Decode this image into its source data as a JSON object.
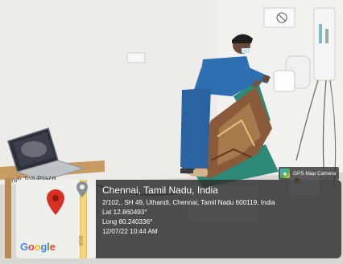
{
  "scene": {
    "wall_sign": "ndi Toll Plaza",
    "colors": {
      "wall": "#ecebe7",
      "floor": "#d8d6d1",
      "scrubs": "#2d6fb0",
      "chair": "#2e8a78",
      "saree": "#8a5a3a",
      "laptop_screen": "#2a2f38"
    }
  },
  "watermark": {
    "app_name": "GPS Map Camera",
    "icon": "gps-map-camera-logo-icon"
  },
  "map": {
    "brand": "Google",
    "road_label": "ECR",
    "pin_color": "#d93025",
    "icons": [
      "location-pin-icon",
      "gray-location-pin-icon"
    ]
  },
  "geotag": {
    "title": "Chennai, Tamil Nadu, India",
    "address": "2/102,, SH 49, Uthandi, Chennai, Tamil Nadu 600119, India",
    "latitude": "Lat 12.860493°",
    "longitude": "Long 80.240336°",
    "timestamp": "12/07/22 10:44 AM"
  }
}
